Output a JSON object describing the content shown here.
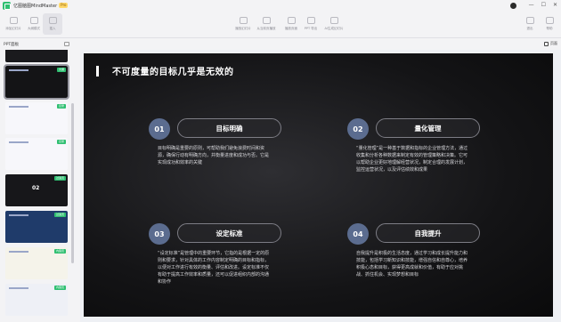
{
  "app": {
    "title": "亿图脑图MindMaster",
    "badge": "Pro"
  },
  "window": {
    "minimize": "—",
    "maximize": "☐",
    "close": "✕"
  },
  "toolbar": {
    "left": [
      {
        "label": "添加幻灯片"
      },
      {
        "label": "大纲模式"
      },
      {
        "label": "插入"
      }
    ],
    "middle": [
      {
        "label": "播放幻灯片"
      },
      {
        "label": "从当前页播放"
      },
      {
        "label": "播放页面"
      },
      {
        "label": "PPT 导出"
      },
      {
        "label": "AI生成幻灯片"
      }
    ],
    "right": [
      {
        "label": "退出"
      },
      {
        "label": "帮助"
      }
    ]
  },
  "panel": {
    "title": "PPT面板",
    "view_button": "页面"
  },
  "thumbnails": [
    {
      "tag": "",
      "num": "",
      "bg": "#1a1a1d"
    },
    {
      "tag": "大纲",
      "num": "",
      "bg": "#141416"
    },
    {
      "tag": "目录",
      "num": "",
      "bg": "#f7f7fb"
    },
    {
      "tag": "目录",
      "num": "",
      "bg": "#f7f7fb"
    },
    {
      "tag": "过渡页",
      "num": "02",
      "bg": "#17171a"
    },
    {
      "tag": "过渡页",
      "num": "",
      "bg": "#1f3b6a"
    },
    {
      "tag": "内容页",
      "num": "",
      "bg": "#f5f3ea"
    },
    {
      "tag": "内容页",
      "num": "",
      "bg": "#eef0f6"
    }
  ],
  "slide": {
    "title": "不可度量的目标几乎是无效的",
    "items": [
      {
        "num": "01",
        "heading": "目标明确",
        "text": "目标明确是重要的原则，可帮助我们避免浪费时间和资源，确保行动有明确方向，并衡量进度和成功与否。它是实现成功和效率的关键"
      },
      {
        "num": "02",
        "heading": "量化管理",
        "text": "“量化管理”是一种基于数据和指标的企业管理方法，通过收集和分析各种数据来制定有效的管理策略和决策。它可以帮助企业更好地理解经营状况，制定合理的发展计划，监控运营状况，以及评估绩效和成果"
      },
      {
        "num": "03",
        "heading": "设定标准",
        "text": "“设定标准”是管理中的重要环节，它指的是根据一定的原则和要求，针对具体的工作内容制定明确的目标和指标，以便对工作进行有效的衡量、评估和改进。设定标准不仅有助于提高工作效率和质量，还可以促进组织内部的沟通和协作"
      },
      {
        "num": "04",
        "heading": "自我提升",
        "text": "自我提升是积极的生活态度，通过学习和成长提升能力和技能，包括学习新知识和技能，增强自信和自尊心，培养积极心态和目标，获得更高成就和价值，有助于应对挑战、抓住机会、实现梦想和目标"
      }
    ]
  },
  "colors": {
    "slide_bg": "#141416",
    "number_circle": "#5b6c8f",
    "accent_green": "#2fbf71"
  }
}
